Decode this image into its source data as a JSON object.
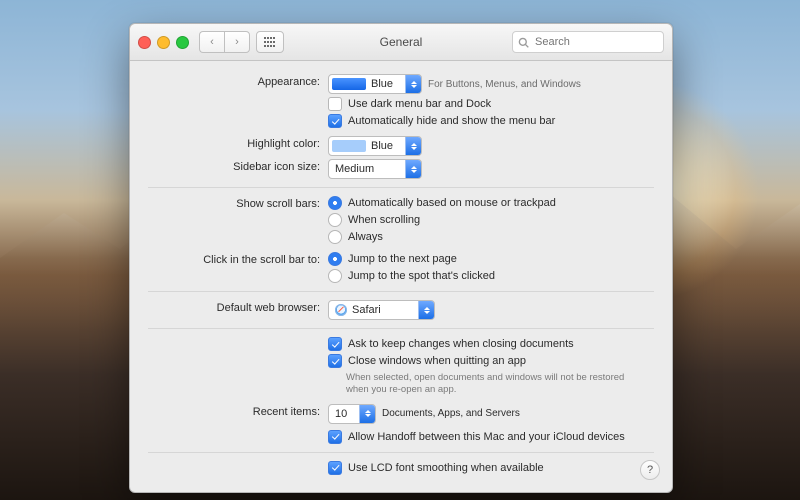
{
  "window": {
    "title": "General"
  },
  "toolbar": {
    "search_placeholder": "Search"
  },
  "appearance": {
    "label": "Appearance:",
    "value": "Blue",
    "hint": "For Buttons, Menus, and Windows",
    "dark_menu": {
      "label": "Use dark menu bar and Dock",
      "checked": false
    },
    "auto_hide": {
      "label": "Automatically hide and show the menu bar",
      "checked": true
    }
  },
  "highlight": {
    "label": "Highlight color:",
    "value": "Blue"
  },
  "sidebar": {
    "label": "Sidebar icon size:",
    "value": "Medium"
  },
  "scrollbars": {
    "label": "Show scroll bars:",
    "options": [
      {
        "label": "Automatically based on mouse or trackpad",
        "selected": true
      },
      {
        "label": "When scrolling",
        "selected": false
      },
      {
        "label": "Always",
        "selected": false
      }
    ]
  },
  "scrollclick": {
    "label": "Click in the scroll bar to:",
    "options": [
      {
        "label": "Jump to the next page",
        "selected": true
      },
      {
        "label": "Jump to the spot that's clicked",
        "selected": false
      }
    ]
  },
  "browser": {
    "label": "Default web browser:",
    "value": "Safari"
  },
  "docs": {
    "ask_keep": {
      "label": "Ask to keep changes when closing documents",
      "checked": true
    },
    "close_windows": {
      "label": "Close windows when quitting an app",
      "checked": true
    },
    "close_hint": "When selected, open documents and windows will not be restored when you re-open an app."
  },
  "recent": {
    "label": "Recent items:",
    "value": "10",
    "suffix": "Documents, Apps, and Servers"
  },
  "handoff": {
    "label": "Allow Handoff between this Mac and your iCloud devices",
    "checked": true
  },
  "lcd": {
    "label": "Use LCD font smoothing when available",
    "checked": true
  },
  "help": "?"
}
